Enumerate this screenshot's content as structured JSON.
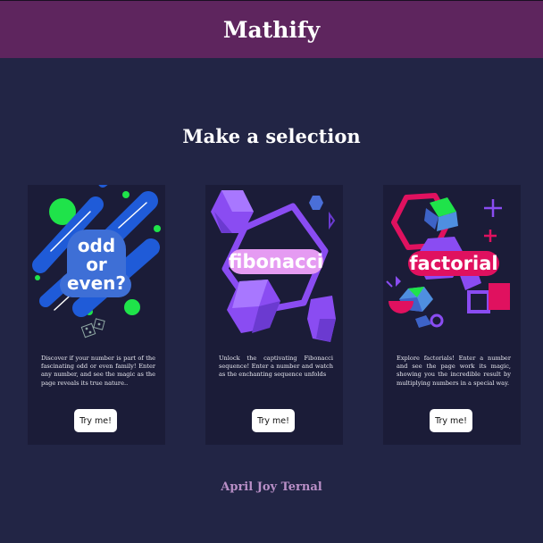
{
  "header": {
    "title": "Mathify"
  },
  "main": {
    "title": "Make a selection",
    "cards": [
      {
        "art_text": [
          "odd",
          "or",
          "even?"
        ],
        "description": "Discover if your number is part of the fascinating odd or even family! Enter any number, and see the magic as the page reveals its true nature..",
        "button_label": "Try me!"
      },
      {
        "art_text": [
          "fibonacci"
        ],
        "description": "Unlock the captivating Fibonacci sequence! Enter a number and watch as the enchanting sequence unfolds",
        "button_label": "Try me!"
      },
      {
        "art_text": [
          "factorial"
        ],
        "description": "Explore factorials! Enter a number and see the page work its magic, showing you the incredible result by multiplying numbers in a special way.",
        "button_label": "Try me!"
      }
    ]
  },
  "footer": {
    "author": "April Joy Ternal"
  },
  "colors": {
    "header_bg": "#5e255e",
    "page_bg": "#222545",
    "card_bg": "#1b1c38",
    "footer_text": "#b98fc7",
    "blue": "#1f5bd8",
    "green": "#1fe34a",
    "purple": "#8a4cf2",
    "magenta": "#e0115f"
  }
}
